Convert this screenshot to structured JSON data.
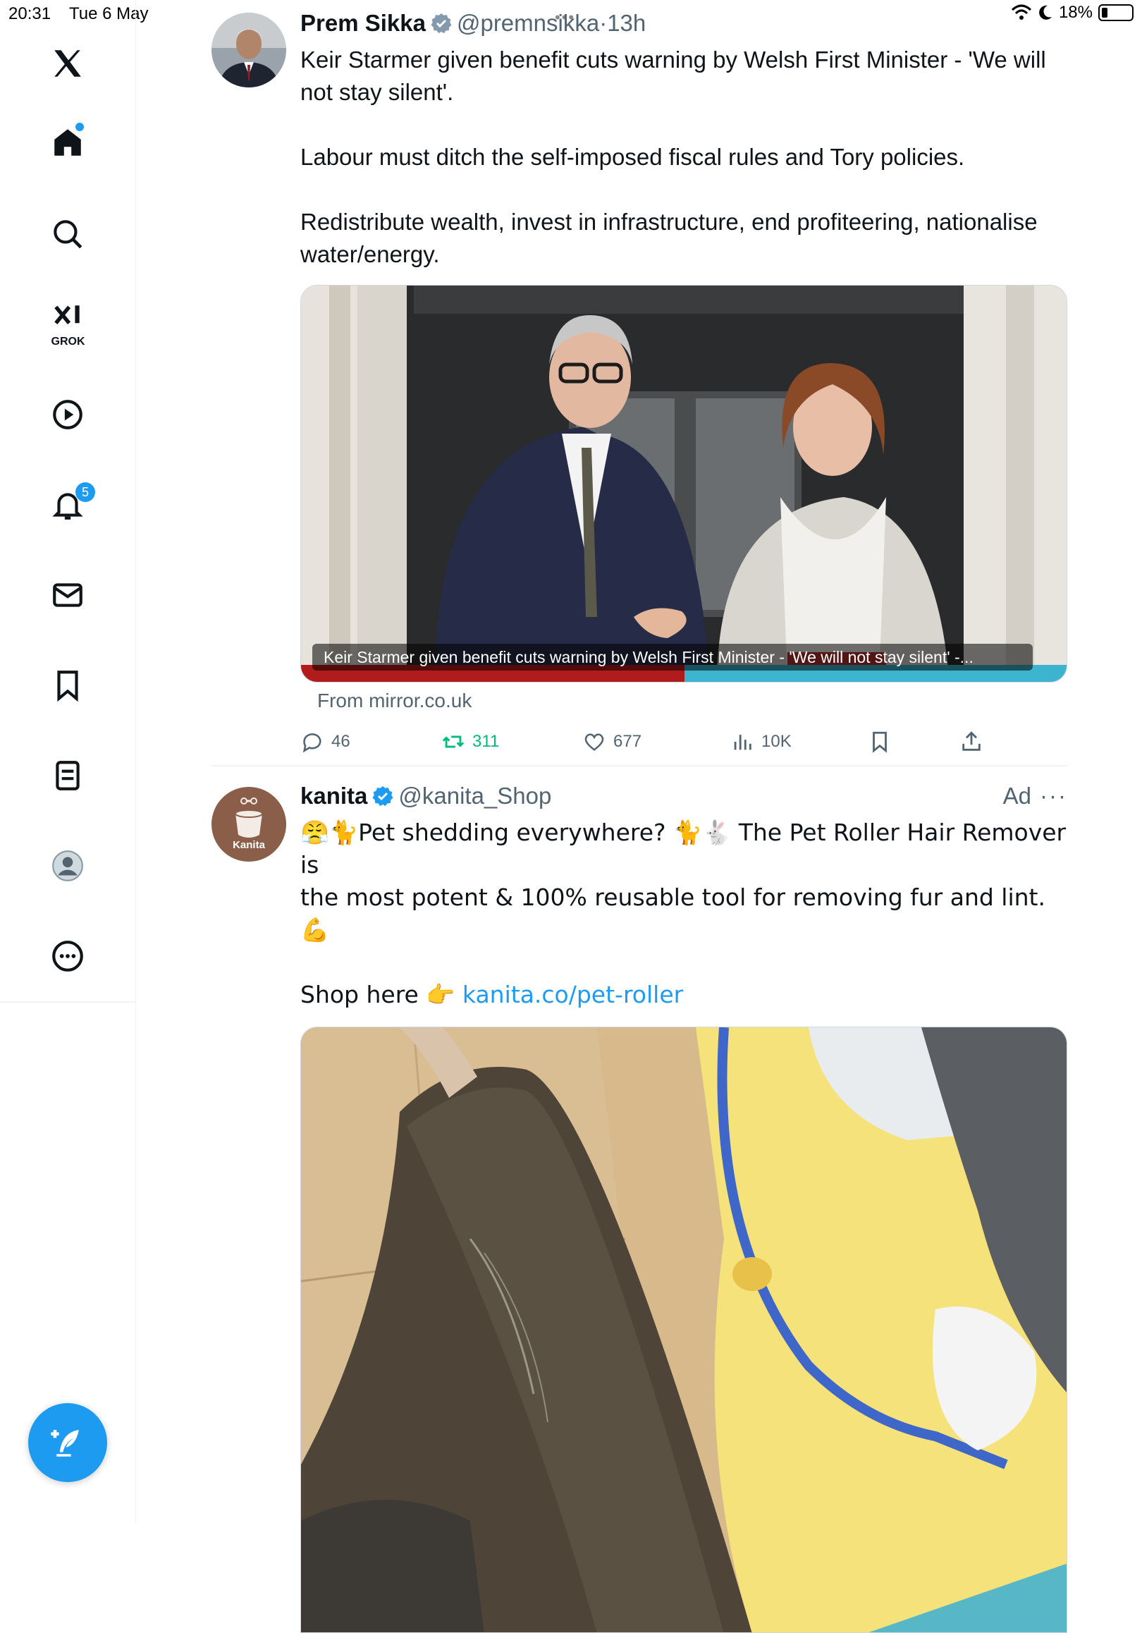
{
  "status_bar": {
    "time": "20:31",
    "date": "Tue 6 May",
    "battery": "18%"
  },
  "sidebar": {
    "logo": "x-logo-icon",
    "grok_label": "GROK",
    "notifications_badge": "5"
  },
  "tweets": [
    {
      "author": "Prem Sikka",
      "handle": "@premnsikka",
      "time": "13h",
      "text": "Keir Starmer given benefit cuts warning by Welsh First Minister - 'We will not stay silent'.\n\nLabour must ditch the self-imposed fiscal rules and Tory policies.\n\nRedistribute wealth, invest in infrastructure, end profiteering, nationalise water/energy.",
      "card_caption": "Keir Starmer given benefit cuts warning by Welsh First Minister - 'We will not stay silent' -...",
      "card_source": "From mirror.co.uk",
      "replies": "46",
      "retweets": "311",
      "likes": "677",
      "views": "10K"
    },
    {
      "author": "kanita",
      "handle": "@kanita_Shop",
      "ad_label": "Ad",
      "avatar_label": "Kanita",
      "text_line1": "😤🐈Pet shedding everywhere? 🐈🐇 The Pet Roller Hair Remover is",
      "text_line2": "the most potent & 100% reusable tool for removing fur and lint. 💪",
      "shop_text": "Shop here 👉 ",
      "shop_link": "kanita.co/pet-roller"
    }
  ],
  "colors": {
    "accent": "#1d9bf0",
    "retweet_green": "#00ba7c",
    "muted": "#536471"
  }
}
